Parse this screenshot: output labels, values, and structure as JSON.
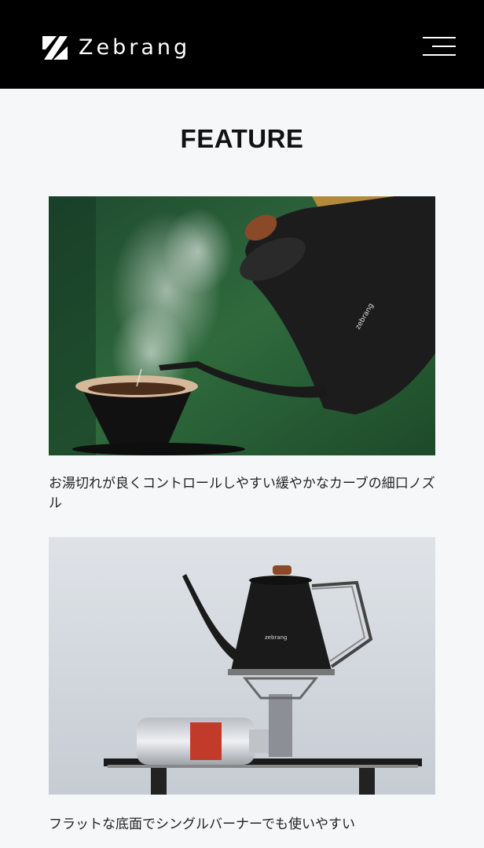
{
  "header": {
    "brand": "Zebrang",
    "logo_icon": "zebrang-logo-mark",
    "menu_icon": "hamburger-menu-icon"
  },
  "main": {
    "section_title": "FEATURE",
    "features": [
      {
        "image": "kettle-pouring-over-coffee-dripper",
        "caption": "お湯切れが良くコントロールしやすい緩やかなカーブの細口ノズル"
      },
      {
        "image": "kettle-on-single-burner-stove",
        "caption": "フラットな底面でシングルバーナーでも使いやすい"
      }
    ]
  },
  "colors": {
    "header_bg": "#000000",
    "page_bg": "#f6f7f8",
    "text": "#111111"
  }
}
